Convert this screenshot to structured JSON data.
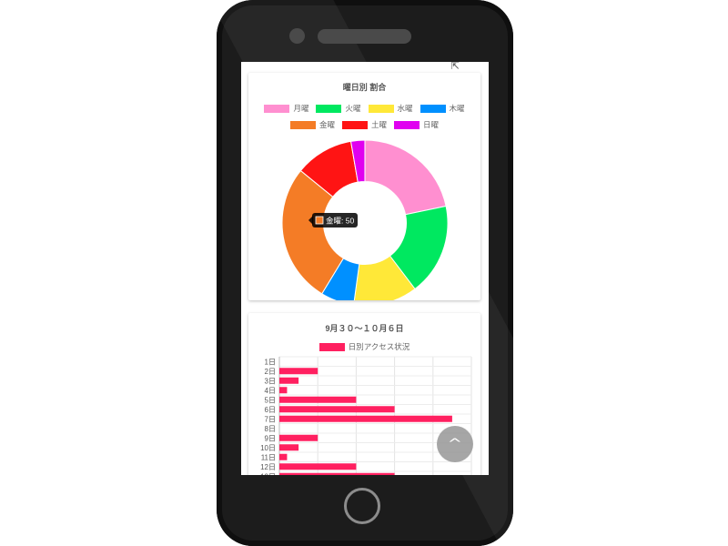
{
  "donut": {
    "title": "曜日別 割合",
    "tooltip": "金曜: 50"
  },
  "bar": {
    "title": "9月３０～１０月６日",
    "legend": "日別アクセス状況"
  },
  "colors": {
    "bar": "#ff2060"
  },
  "icons": {
    "scroll_top": "chevron-up-icon",
    "cursor": "cursor-icon"
  },
  "chart_data": [
    {
      "type": "pie",
      "title": "曜日別 割合",
      "hole": 0.5,
      "legend_placement": "top",
      "labels": [
        "月曜",
        "火曜",
        "水曜",
        "木曜",
        "金曜",
        "土曜",
        "日曜"
      ],
      "values": [
        40,
        33,
        23,
        12,
        50,
        21,
        5
      ],
      "colors": [
        "#ff8fd0",
        "#00e860",
        "#ffe838",
        "#0090ff",
        "#f47c26",
        "#ff1414",
        "#e000f0"
      ]
    },
    {
      "type": "bar",
      "orientation": "horizontal",
      "title": "9月３０～１０月６日",
      "categories": [
        "1日",
        "2日",
        "3日",
        "4日",
        "5日",
        "6日",
        "7日",
        "8日",
        "9日",
        "10日",
        "11日",
        "12日",
        "13日"
      ],
      "series": [
        {
          "name": "日別アクセス状況",
          "values": [
            0,
            10,
            5,
            2,
            20,
            30,
            45,
            0,
            10,
            5,
            2,
            20,
            30
          ]
        }
      ],
      "xlim": [
        0,
        50
      ],
      "grid": true
    }
  ]
}
